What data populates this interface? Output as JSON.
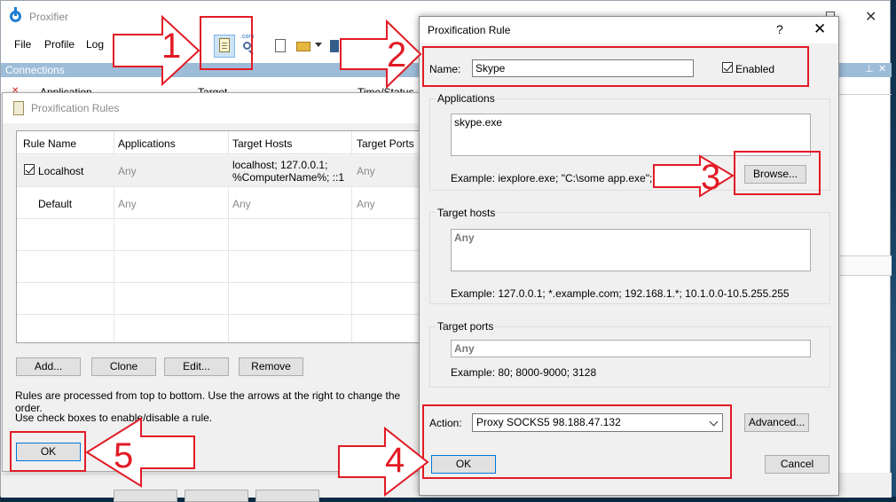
{
  "main_window": {
    "title": "Proxifier",
    "menu": [
      "File",
      "Profile",
      "Log"
    ],
    "connections_title": "Connections",
    "columns": [
      "Application",
      "Target",
      "Time/Status"
    ],
    "toolbar_icons": [
      "proxification-rules-icon",
      "name-resolution-icon",
      "new-profile-icon",
      "open-profile-icon",
      "save-profile-icon"
    ]
  },
  "rules_dialog": {
    "title": "Proxification Rules",
    "columns": [
      "Rule Name",
      "Applications",
      "Target Hosts",
      "Target Ports"
    ],
    "rows": [
      {
        "name": "Localhost",
        "applications": "Any",
        "hosts_line1": "localhost; 127.0.0.1;",
        "hosts_line2": "%ComputerName%; ::1",
        "ports": "Any",
        "checked": true
      },
      {
        "name": "Default",
        "applications": "Any",
        "hosts_line1": "Any",
        "hosts_line2": "",
        "ports": "Any",
        "checked": false
      }
    ],
    "buttons": {
      "add": "Add...",
      "clone": "Clone",
      "edit": "Edit...",
      "remove": "Remove",
      "ok": "OK"
    },
    "help_text_1": "Rules are processed from top to bottom. Use the arrows at the right to change the order.",
    "help_text_2": "Use check boxes to enable/disable a rule."
  },
  "rule_dialog": {
    "title": "Proxification Rule",
    "help": "?",
    "close": "✕",
    "name_label": "Name:",
    "name_value": "Skype",
    "enabled_label": "Enabled",
    "enabled_checked": true,
    "applications_label": "Applications",
    "applications_value": "skype.exe",
    "applications_example": "Example: iexplore.exe; \"C:\\some app.exe\"; fire",
    "browse_label": "Browse...",
    "target_hosts_label": "Target hosts",
    "target_hosts_value": "Any",
    "target_hosts_example": "Example: 127.0.0.1; *.example.com; 192.168.1.*; 10.1.0.0-10.5.255.255",
    "target_ports_label": "Target ports",
    "target_ports_value": "Any",
    "target_ports_example": "Example: 80; 8000-9000; 3128",
    "action_label": "Action:",
    "action_value": "Proxy SOCKS5 98.188.47.132",
    "advanced_label": "Advanced...",
    "ok_label": "OK",
    "cancel_label": "Cancel"
  },
  "annotations": {
    "color": "#e21b25",
    "steps": [
      "1",
      "2",
      "3",
      "4",
      "5"
    ]
  }
}
